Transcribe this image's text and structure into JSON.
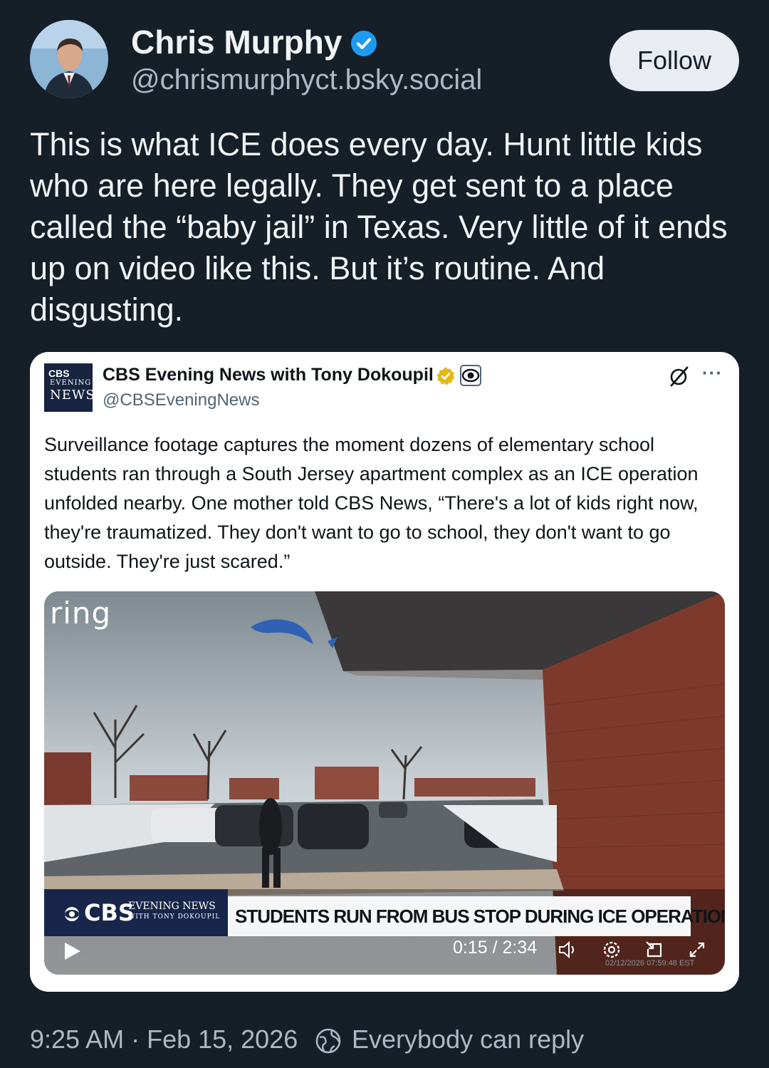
{
  "author": {
    "name": "Chris Murphy",
    "handle": "@chrismurphyct.bsky.social",
    "verified": true
  },
  "follow_label": "Follow",
  "post_text": "This is what ICE does every day. Hunt little kids who are here legally. They get sent to a place called the “baby jail” in Texas. Very little of it ends up on video like this. But it’s routine. And disgusting.",
  "quote": {
    "logo_text": [
      "CBS",
      "EVENING",
      "NEWS"
    ],
    "name": "CBS Evening News with Tony Dokoupil",
    "handle": "@CBSEveningNews",
    "text": "Surveillance footage captures the moment dozens of elementary school students ran through a South Jersey apartment complex as an ICE operation unfolded nearby. One mother told CBS News, “There's a lot of kids right now, they're traumatized. They don't want to go to school, they don't want to go outside. They're just scared.”",
    "more_label": "···",
    "video": {
      "watermark": "ring",
      "network_logo": "CBS",
      "show_name": "EVENING NEWS",
      "show_subtitle": "WITH TONY DOKOUPIL",
      "headline": "STUDENTS RUN FROM BUS STOP DURING ICE OPERATION",
      "time": "0:15 / 2:34",
      "camera_timestamp": "02/12/2026 07:59:48 EST",
      "progress": 0.096
    }
  },
  "meta": {
    "timestamp": "9:25 AM · Feb 15, 2026",
    "reply_setting": "Everybody can reply"
  },
  "colors": {
    "background": "#161e27",
    "verified_blue": "#1d9bf0",
    "gold_badge": "#e2b719",
    "cbs_navy": "#17264a"
  }
}
